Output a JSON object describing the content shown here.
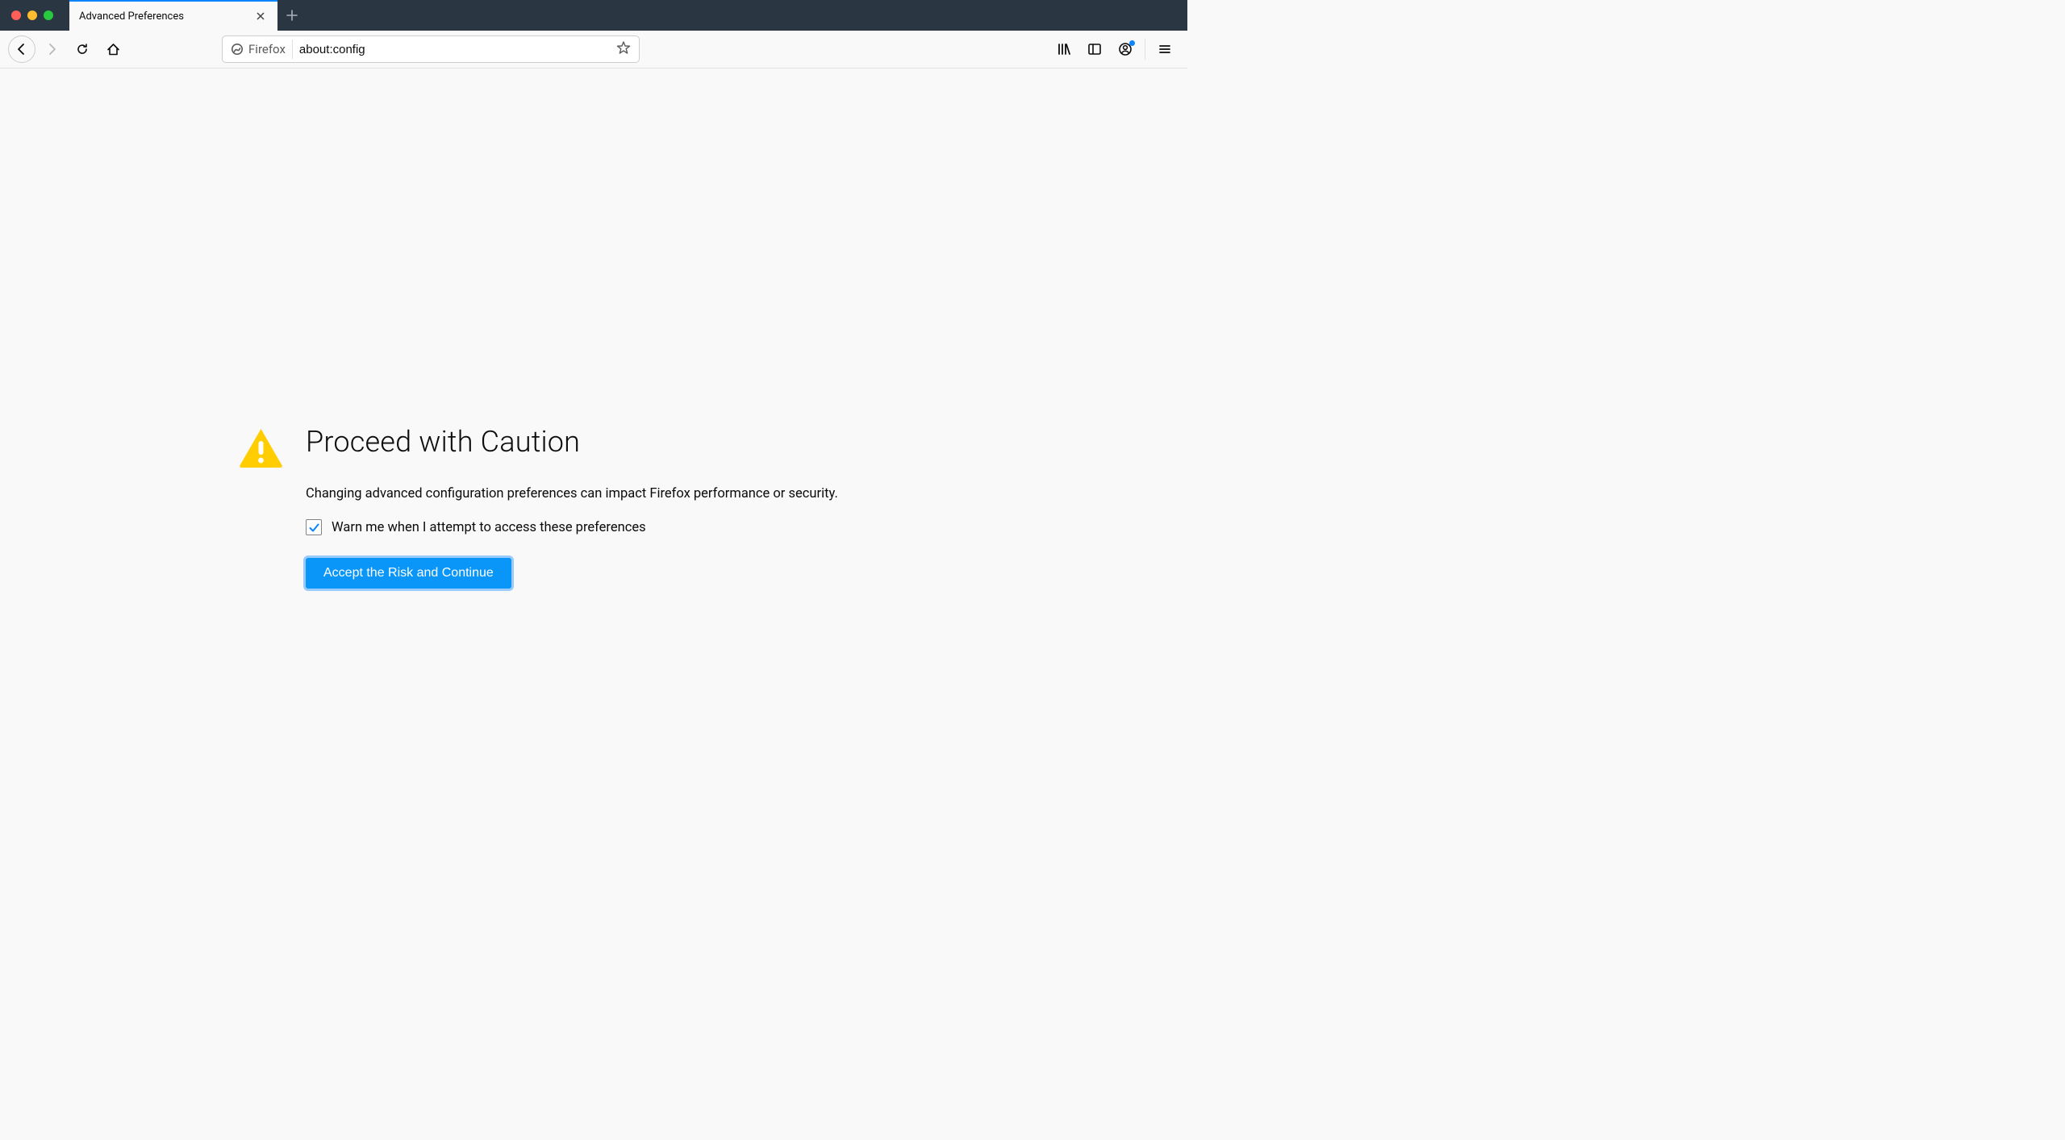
{
  "titlebar": {
    "tab_title": "Advanced Preferences"
  },
  "urlbar": {
    "identity_label": "Firefox",
    "url": "about:config"
  },
  "warning": {
    "title": "Proceed with Caution",
    "description": "Changing advanced configuration preferences can impact Firefox performance or security.",
    "checkbox_label": "Warn me when I attempt to access these preferences",
    "checkbox_checked": true,
    "accept_label": "Accept the Risk and Continue"
  }
}
